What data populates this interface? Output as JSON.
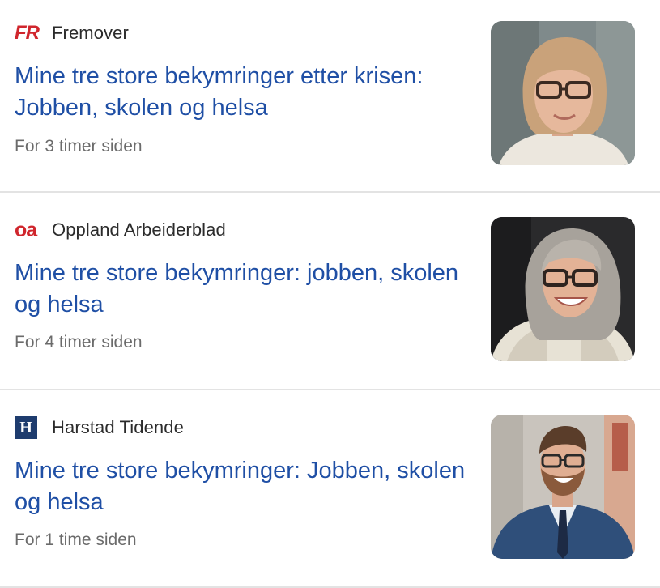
{
  "articles": [
    {
      "source": "Fremover",
      "source_logo": "FR",
      "source_color": "#d0262d",
      "headline": "Mine tre store bekymringer etter krisen: Jobben, skolen og helsa",
      "time": "For 3 timer siden",
      "thumbnail_icon": "portrait-woman-glasses-photo"
    },
    {
      "source": "Oppland Arbeiderblad",
      "source_logo": "oa",
      "source_color": "#d0262d",
      "headline": "Mine tre store bekymringer: jobben, skolen og helsa",
      "time": "For 4 timer siden",
      "thumbnail_icon": "portrait-woman-grey-hair-photo"
    },
    {
      "source": "Harstad Tidende",
      "source_logo": "H",
      "source_color": "#1e3c6e",
      "headline": "Mine tre store bekymringer: Jobben, skolen og helsa",
      "time": "For 1 time siden",
      "thumbnail_icon": "portrait-man-suit-photo"
    }
  ],
  "colors": {
    "headline": "#1f4fa5",
    "source_text": "#2b2b2b",
    "timestamp": "#6b6b6b",
    "divider": "#e3e3e3"
  }
}
